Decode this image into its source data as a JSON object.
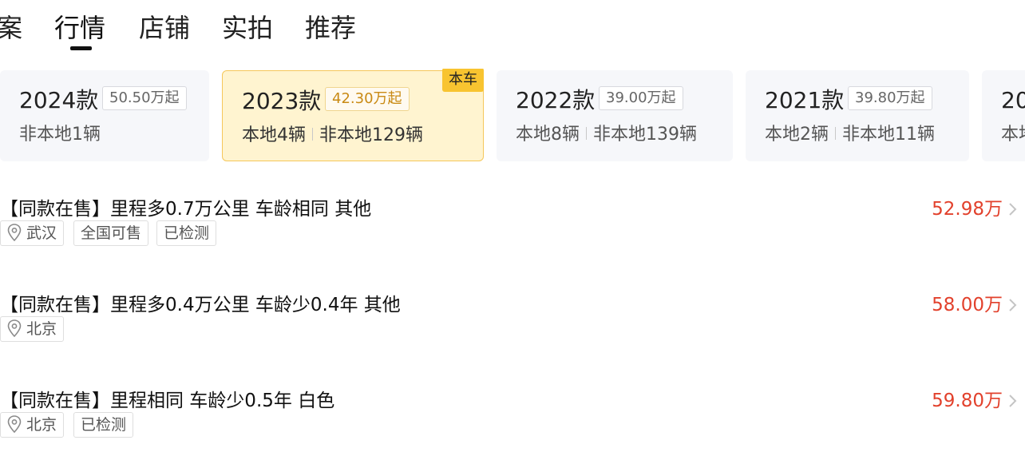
{
  "tabs": [
    {
      "label": "案"
    },
    {
      "label": "行情"
    },
    {
      "label": "店铺"
    },
    {
      "label": "实拍"
    },
    {
      "label": "推荐"
    }
  ],
  "cards": [
    {
      "year": "2024款",
      "price": "50.50万起",
      "local": "",
      "nonlocal": "非本地1辆"
    },
    {
      "year": "2023款",
      "price": "42.30万起",
      "local": "本地4辆",
      "nonlocal": "非本地129辆",
      "badge": "本车"
    },
    {
      "year": "2022款",
      "price": "39.00万起",
      "local": "本地8辆",
      "nonlocal": "非本地139辆"
    },
    {
      "year": "2021款",
      "price": "39.80万起",
      "local": "本地2辆",
      "nonlocal": "非本地11辆"
    },
    {
      "year": "20",
      "local": "本地"
    }
  ],
  "listings": [
    {
      "title": "【同款在售】里程多0.7万公里 车龄相同 其他",
      "price": "52.98万",
      "tags": [
        "武汉",
        "全国可售",
        "已检测"
      ]
    },
    {
      "title": "【同款在售】里程多0.4万公里 车龄少0.4年 其他",
      "price": "58.00万",
      "tags": [
        "北京"
      ]
    },
    {
      "title": "【同款在售】里程相同 车龄少0.5年 白色",
      "price": "59.80万",
      "tags": [
        "北京",
        "已检测"
      ]
    }
  ],
  "colors": {
    "price": "#e2412c",
    "badge": "#f8c430",
    "selected_card": "#fff4d0"
  },
  "icons": {
    "location": "location-pin-icon",
    "more": "chevron-right-icon"
  }
}
